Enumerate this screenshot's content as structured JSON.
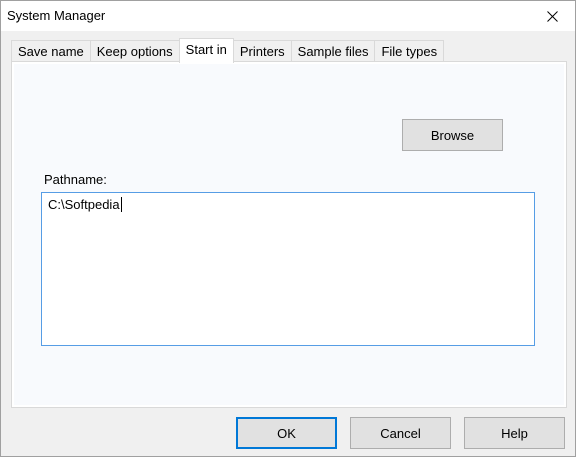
{
  "window": {
    "title": "System Manager"
  },
  "tabs": [
    {
      "label": "Save name",
      "active": false
    },
    {
      "label": "Keep options",
      "active": false
    },
    {
      "label": "Start in",
      "active": true
    },
    {
      "label": "Printers",
      "active": false
    },
    {
      "label": "Sample files",
      "active": false
    },
    {
      "label": "File types",
      "active": false
    }
  ],
  "start_in": {
    "browse_label": "Browse",
    "pathname_label": "Pathname:",
    "pathname_value": "C:\\Softpedia"
  },
  "footer": {
    "ok_label": "OK",
    "cancel_label": "Cancel",
    "help_label": "Help"
  },
  "colors": {
    "focus_border": "#0078d7",
    "field_border": "#569de5",
    "panel_bg": "#f8fafd"
  },
  "icons": {
    "close": "close-icon"
  }
}
